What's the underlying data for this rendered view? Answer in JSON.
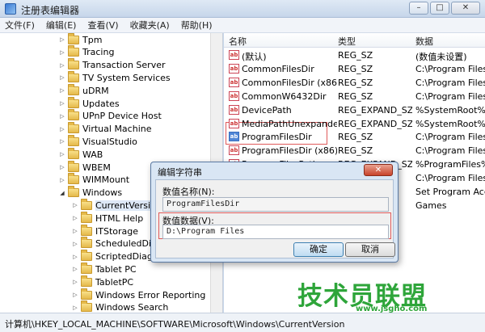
{
  "window": {
    "title": "注册表编辑器",
    "min_glyph": "–",
    "max_glyph": "□",
    "close_glyph": "✕"
  },
  "menu": [
    "文件(F)",
    "编辑(E)",
    "查看(V)",
    "收藏夹(A)",
    "帮助(H)"
  ],
  "tree": {
    "items": [
      {
        "label": "Tpm",
        "expanded": false
      },
      {
        "label": "Tracing",
        "expanded": false
      },
      {
        "label": "Transaction Server",
        "expanded": false
      },
      {
        "label": "TV System Services",
        "expanded": false
      },
      {
        "label": "uDRM",
        "expanded": false
      },
      {
        "label": "Updates",
        "expanded": false
      },
      {
        "label": "UPnP Device Host",
        "expanded": false
      },
      {
        "label": "Virtual Machine",
        "expanded": false
      },
      {
        "label": "VisualStudio",
        "expanded": false
      },
      {
        "label": "WAB",
        "expanded": false
      },
      {
        "label": "WBEM",
        "expanded": false
      },
      {
        "label": "WIMMount",
        "expanded": false
      },
      {
        "label": "Windows",
        "expanded": true
      },
      {
        "label": "CurrentVersion",
        "expanded": false,
        "child": true,
        "selected": true
      },
      {
        "label": "HTML Help",
        "expanded": false,
        "child": true
      },
      {
        "label": "ITStorage",
        "expanded": false,
        "child": true
      },
      {
        "label": "ScheduledDiagn",
        "expanded": false,
        "child": true
      },
      {
        "label": "ScriptedDiagnos",
        "expanded": false,
        "child": true
      },
      {
        "label": "Tablet PC",
        "expanded": false,
        "child": true
      },
      {
        "label": "TabletPC",
        "expanded": false,
        "child": true
      },
      {
        "label": "Windows Error Reporting",
        "expanded": false,
        "child": true
      },
      {
        "label": "Windows Search",
        "expanded": false,
        "child": true
      }
    ]
  },
  "list": {
    "headers": {
      "name": "名称",
      "type": "类型",
      "data": "数据"
    },
    "rows": [
      {
        "name": "(默认)",
        "type": "REG_SZ",
        "data": "(数值未设置)",
        "icon": "string-value-icon"
      },
      {
        "name": "CommonFilesDir",
        "type": "REG_SZ",
        "data": "C:\\Program Files\\",
        "icon": "string-value-icon"
      },
      {
        "name": "CommonFilesDir (x86)",
        "type": "REG_SZ",
        "data": "C:\\Program Files (",
        "icon": "string-value-icon"
      },
      {
        "name": "CommonW6432Dir",
        "type": "REG_SZ",
        "data": "C:\\Program Files\\",
        "icon": "string-value-icon"
      },
      {
        "name": "DevicePath",
        "type": "REG_EXPAND_SZ",
        "data": "%SystemRoot%\\in",
        "icon": "string-value-icon"
      },
      {
        "name": "MediaPathUnexpanded",
        "type": "REG_EXPAND_SZ",
        "data": "%SystemRoot%\\M",
        "icon": "string-value-icon"
      },
      {
        "name": "ProgramFilesDir",
        "type": "REG_SZ",
        "data": "C:\\Program Files",
        "icon": "string-value-icon",
        "selected": true
      },
      {
        "name": "ProgramFilesDir (x86)",
        "type": "REG_SZ",
        "data": "C:\\Program Files (",
        "icon": "string-value-icon"
      },
      {
        "name": "ProgramFilesPath",
        "type": "REG_EXPAND_SZ",
        "data": "%ProgramFiles%",
        "icon": "string-value-icon"
      },
      {
        "name": "ProgramW6432Dir",
        "type": "REG_SZ",
        "data": "C:\\Program Files",
        "icon": "string-value-icon"
      },
      {
        "name": "",
        "type": "",
        "data": "Set Program Acce",
        "icon": ""
      },
      {
        "name": "",
        "type": "",
        "data": "Games",
        "icon": ""
      }
    ]
  },
  "status": {
    "path": "计算机\\HKEY_LOCAL_MACHINE\\SOFTWARE\\Microsoft\\Windows\\CurrentVersion"
  },
  "dialog": {
    "title": "编辑字符串",
    "close_glyph": "✕",
    "name_label": "数值名称(N):",
    "name_value": "ProgramFilesDir",
    "data_label": "数值数据(V):",
    "data_value": "D:\\Program Files",
    "ok_label": "确定",
    "cancel_label": "取消"
  },
  "watermark": {
    "logo_text": "技术员联盟",
    "url": "www.jsgho.com"
  },
  "colors": {
    "highlight_red": "#e05a5a",
    "watermark_green": "#2ea53a"
  }
}
